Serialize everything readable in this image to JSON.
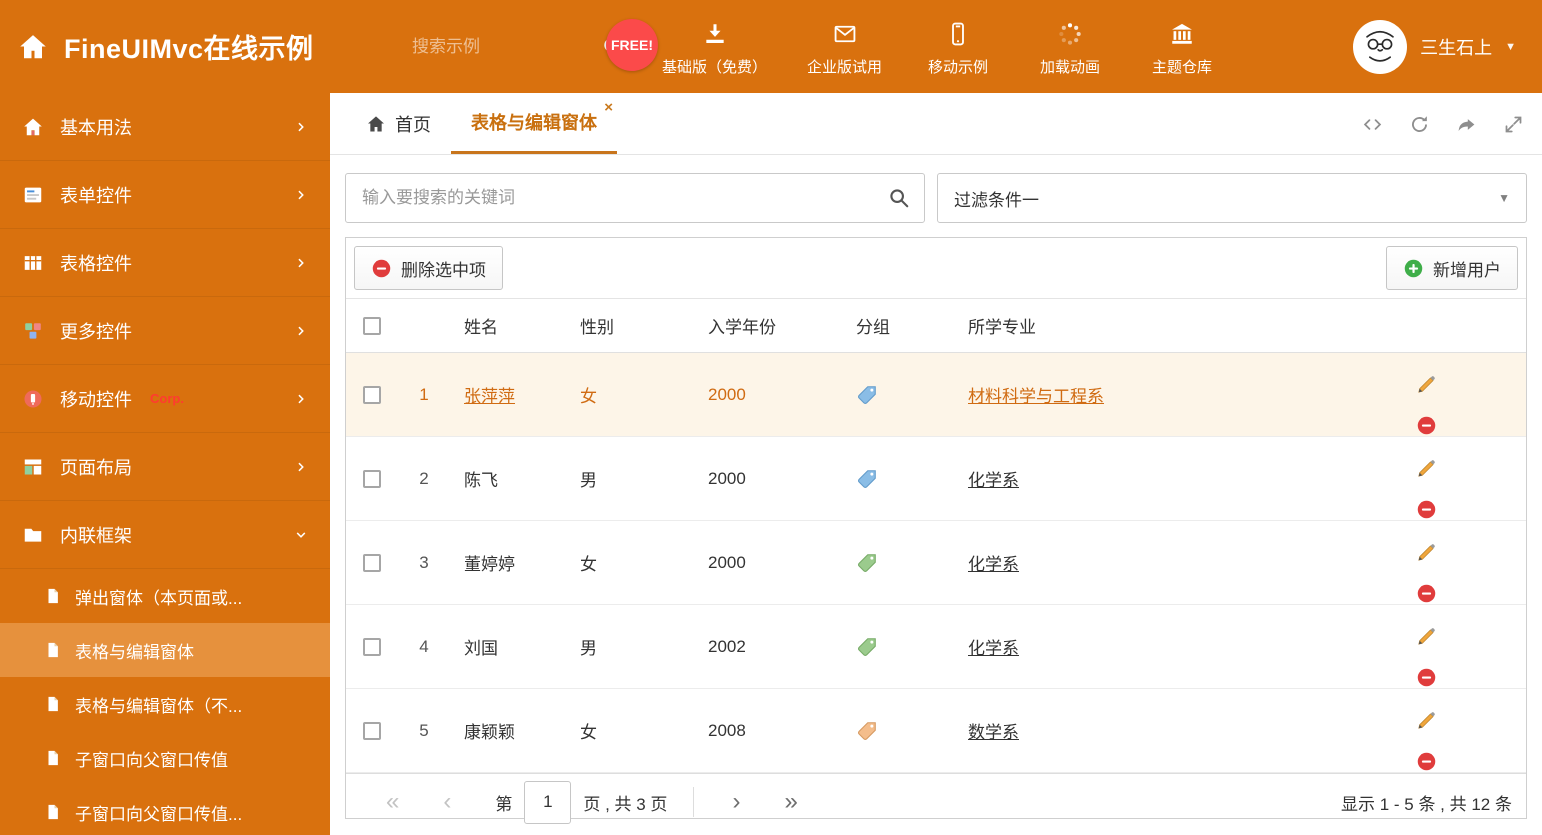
{
  "colors": {
    "primary": "#d9710e",
    "accent_text": "#c9700f",
    "selected_row_bg": "#fdf5e8",
    "free_badge_bg": "#fb4a4a",
    "delete_icon": "#e03c3c",
    "add_icon": "#3fae49"
  },
  "header": {
    "title": "FineUIMvc在线示例",
    "search_placeholder": "搜索示例",
    "free_badge": "FREE!",
    "nav": [
      {
        "label": "基础版（免费）"
      },
      {
        "label": "企业版试用"
      },
      {
        "label": "移动示例"
      },
      {
        "label": "加载动画"
      },
      {
        "label": "主题仓库"
      }
    ],
    "username": "三生石上"
  },
  "sidebar": {
    "items": [
      {
        "label": "基本用法"
      },
      {
        "label": "表单控件"
      },
      {
        "label": "表格控件"
      },
      {
        "label": "更多控件"
      },
      {
        "label": "移动控件",
        "badge": "Corp."
      },
      {
        "label": "页面布局"
      },
      {
        "label": "内联框架"
      }
    ],
    "subitems": [
      {
        "label": "弹出窗体（本页面或..."
      },
      {
        "label": "表格与编辑窗体"
      },
      {
        "label": "表格与编辑窗体（不..."
      },
      {
        "label": "子窗口向父窗口传值"
      },
      {
        "label": "子窗口向父窗口传值..."
      }
    ]
  },
  "tabs": {
    "home": "首页",
    "active": "表格与编辑窗体",
    "close": "×"
  },
  "icons": {
    "caret_down": "▼",
    "first": "«",
    "prev": "‹",
    "next": "›",
    "last": "»"
  },
  "filters": {
    "search_placeholder": "输入要搜索的关键词",
    "filter_selected": "过滤条件一"
  },
  "toolbar": {
    "delete_label": "删除选中项",
    "add_label": "新增用户"
  },
  "table": {
    "headers": [
      "姓名",
      "性别",
      "入学年份",
      "分组",
      "所学专业"
    ],
    "rows": [
      {
        "num": "1",
        "name": "张萍萍",
        "gender": "女",
        "year": "2000",
        "tag": "blue",
        "major": "材料科学与工程系"
      },
      {
        "num": "2",
        "name": "陈飞",
        "gender": "男",
        "year": "2000",
        "tag": "blue",
        "major": "化学系"
      },
      {
        "num": "3",
        "name": "董婷婷",
        "gender": "女",
        "year": "2000",
        "tag": "green",
        "major": "化学系"
      },
      {
        "num": "4",
        "name": "刘国",
        "gender": "男",
        "year": "2002",
        "tag": "green",
        "major": "化学系"
      },
      {
        "num": "5",
        "name": "康颖颖",
        "gender": "女",
        "year": "2008",
        "tag": "orange",
        "major": "数学系"
      }
    ]
  },
  "pagination": {
    "prefix": "第",
    "current_page": "1",
    "suffix": "页 , 共 3 页",
    "summary": "显示 1 - 5 条 , 共 12 条"
  }
}
